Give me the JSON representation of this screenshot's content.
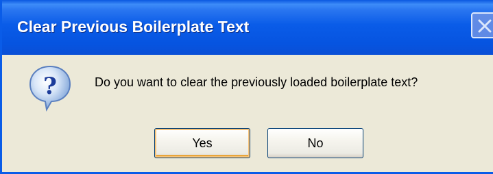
{
  "window": {
    "title": "Clear Previous Boilerplate Text"
  },
  "titlebar": {
    "close_icon": "close-icon"
  },
  "dialog": {
    "icon": "question-icon",
    "message": "Do you want to clear the previously loaded boilerplate text?",
    "buttons": {
      "yes_label": "Yes",
      "no_label": "No"
    },
    "default_button": "Yes"
  },
  "colors": {
    "titlebar_blue": "#0A5CE8",
    "dialog_background": "#ECE9D8",
    "button_border": "#003C74",
    "default_button_focus": "#F6C37A"
  }
}
